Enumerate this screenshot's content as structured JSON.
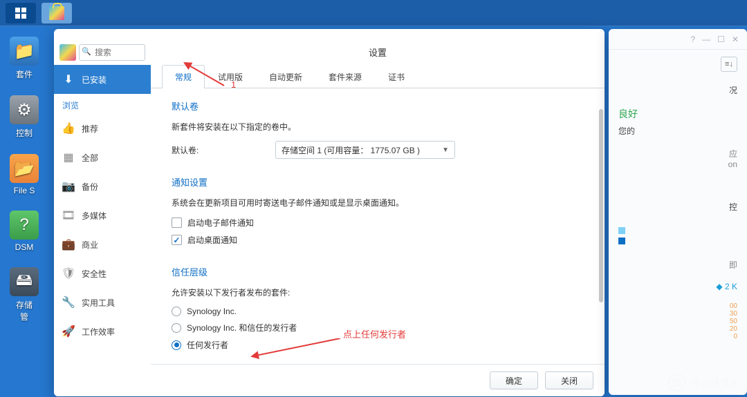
{
  "taskbar": {
    "app_icon": "package-center"
  },
  "desktop": {
    "items": [
      {
        "label": "套件",
        "icon": "ic-blue"
      },
      {
        "label": "控制",
        "icon": "ic-gray"
      },
      {
        "label": "File S",
        "icon": "ic-orange"
      },
      {
        "label": "DSM",
        "icon": "ic-green"
      },
      {
        "label": "存储\n管",
        "icon": "ic-dark"
      }
    ]
  },
  "package_center": {
    "search_placeholder": "搜索",
    "sidebar": {
      "installed": "已安装",
      "browse_header": "浏览",
      "items": [
        "推荐",
        "全部",
        "备份",
        "多媒体",
        "商业",
        "安全性",
        "实用工具",
        "工作效率"
      ]
    }
  },
  "settings_dialog": {
    "title": "设置",
    "tabs": [
      "常规",
      "试用版",
      "自动更新",
      "套件来源",
      "证书"
    ],
    "active_tab": 0,
    "default_volume": {
      "section": "默认卷",
      "desc": "新套件将安装在以下指定的卷中。",
      "label": "默认卷:",
      "value": "存储空间 1 (可用容量： 1775.07 GB )"
    },
    "notification": {
      "section": "通知设置",
      "desc": "系统会在更新项目可用时寄送电子邮件通知或是显示桌面通知。",
      "opt_email": "启动电子邮件通知",
      "opt_desktop": "启动桌面通知",
      "email_checked": false,
      "desktop_checked": true
    },
    "trust": {
      "section": "信任层级",
      "desc": "允许安装以下发行者发布的套件:",
      "options": [
        "Synology Inc.",
        "Synology Inc. 和信任的发行者",
        "任何发行者"
      ],
      "selected": 2
    },
    "buttons": {
      "ok": "确定",
      "cancel": "关闭"
    }
  },
  "annotations": {
    "label1": "1",
    "label2": "点上任何发行者"
  },
  "right_panel": {
    "overview_suffix": "况",
    "status": "良好",
    "sub": "您的",
    "sec1": "应\non",
    "sec2": "即",
    "net": "◆ 2 K",
    "mon": "控"
  },
  "watermark": "什么值得买"
}
